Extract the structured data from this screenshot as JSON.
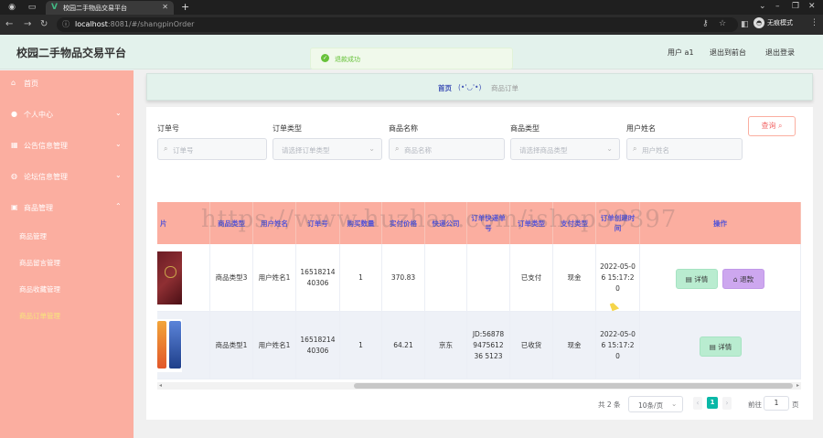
{
  "browser": {
    "tab_title": "校园二手物品交易平台",
    "url_host": "localhost",
    "url_rest": ":8081/#/shangpinOrder",
    "profile_label": "无痕模式"
  },
  "header": {
    "brand": "校园二手物品交易平台",
    "user": "用户 a1",
    "to_front": "退出到前台",
    "logout": "退出登录"
  },
  "toast": {
    "message": "退款成功"
  },
  "sidebar": {
    "items": [
      {
        "label": "首页"
      },
      {
        "label": "个人中心"
      },
      {
        "label": "公告信息管理"
      },
      {
        "label": "论坛信息管理"
      },
      {
        "label": "商品管理"
      }
    ],
    "subitems": [
      {
        "label": "商品管理"
      },
      {
        "label": "商品留言管理"
      },
      {
        "label": "商品收藏管理"
      },
      {
        "label": "商品订单管理"
      }
    ]
  },
  "breadcrumb": {
    "home": "首页",
    "emoticon": "(•'◡'•)",
    "current": "商品订单"
  },
  "filters": {
    "order_no": {
      "label": "订单号",
      "placeholder": "订单号"
    },
    "order_type": {
      "label": "订单类型",
      "placeholder": "请选择订单类型"
    },
    "product_name": {
      "label": "商品名称",
      "placeholder": "商品名称"
    },
    "product_type": {
      "label": "商品类型",
      "placeholder": "请选择商品类型"
    },
    "user_name": {
      "label": "用户姓名",
      "placeholder": "用户姓名"
    },
    "search_label": "查询"
  },
  "table": {
    "headers": [
      "片",
      "商品类型",
      "用户姓名",
      "订单号",
      "购买数量",
      "实付价格",
      "快递公司",
      "订单快递单号",
      "订单类型",
      "支付类型",
      "订单创建时间",
      "操作"
    ],
    "rows": [
      {
        "type": "商品类型3",
        "user": "用户姓名1",
        "order_no": "1651821440306",
        "qty": "1",
        "price": "370.83",
        "courier": "",
        "tracking": "",
        "order_type": "已支付",
        "pay_type": "现金",
        "created": "2022-05-06 15:17:20",
        "detail": "详情",
        "refund": "退款"
      },
      {
        "type": "商品类型1",
        "user": "用户姓名1",
        "order_no": "1651821440306",
        "qty": "1",
        "price": "64.21",
        "courier": "京东",
        "tracking": "JD:56878947561236 5123",
        "order_type": "已收货",
        "pay_type": "现金",
        "created": "2022-05-06 15:17:20",
        "detail": "详情"
      }
    ]
  },
  "pagination": {
    "total": "共 2 条",
    "page_size": "10条/页",
    "current": "1",
    "goto_label": "前往",
    "goto_value": "1",
    "page_unit": "页"
  },
  "watermark": "https://www.huzhan.com/ishop39397"
}
